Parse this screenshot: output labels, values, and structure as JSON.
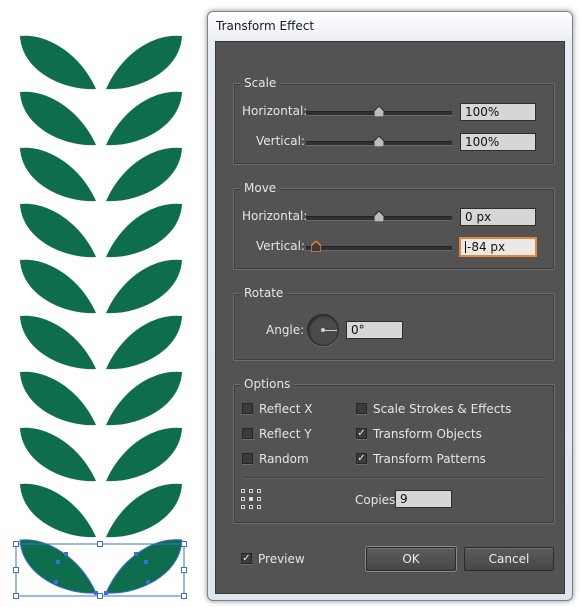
{
  "dialog": {
    "title": "Transform Effect",
    "scale": {
      "group_title": "Scale",
      "horizontal_label": "Horizontal:",
      "horizontal_value": "100%",
      "vertical_label": "Vertical:",
      "vertical_value": "100%"
    },
    "move": {
      "group_title": "Move",
      "horizontal_label": "Horizontal:",
      "horizontal_value": "0 px",
      "vertical_label": "Vertical:",
      "vertical_value": "-84 px"
    },
    "rotate": {
      "group_title": "Rotate",
      "angle_label": "Angle:",
      "angle_value": "0°"
    },
    "options": {
      "group_title": "Options",
      "reflect_x": {
        "label": "Reflect X",
        "checked": false
      },
      "reflect_y": {
        "label": "Reflect Y",
        "checked": false
      },
      "random": {
        "label": "Random",
        "checked": false
      },
      "scale_strokes": {
        "label": "Scale Strokes & Effects",
        "checked": false
      },
      "transform_objects": {
        "label": "Transform Objects",
        "checked": true
      },
      "transform_patterns": {
        "label": "Transform Patterns",
        "checked": true
      },
      "copies_label": "Copies",
      "copies_value": "9"
    },
    "preview": {
      "label": "Preview",
      "checked": true
    },
    "ok_label": "OK",
    "cancel_label": "Cancel"
  },
  "artwork": {
    "leaf_color": "#0e6d4c",
    "selection_color": "#3a6fd8",
    "pairs": 10
  }
}
